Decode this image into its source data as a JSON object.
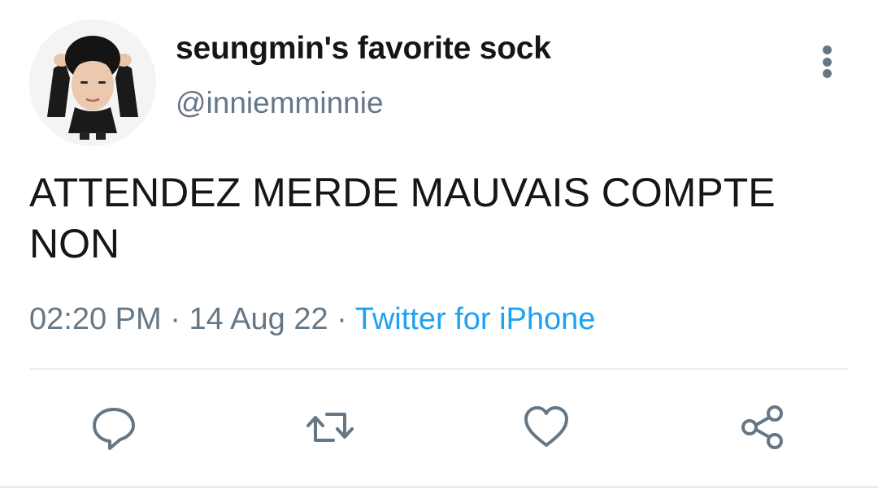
{
  "tweet": {
    "display_name": "seungmin's favorite sock",
    "handle": "@inniemminnie",
    "text_line1": "ATTENDEZ MERDE MAUVAIS COMPTE",
    "text_line2": "NON",
    "time": "02:20 PM",
    "separator": "·",
    "date": "14 Aug 22",
    "source": "Twitter for iPhone"
  },
  "actions": {
    "reply_icon": "reply-icon",
    "retweet_icon": "retweet-icon",
    "like_icon": "heart-icon",
    "share_icon": "share-icon"
  },
  "colors": {
    "text": "#14171a",
    "secondary": "#657786",
    "link": "#1da1f2",
    "divider": "#e6ecf0"
  }
}
